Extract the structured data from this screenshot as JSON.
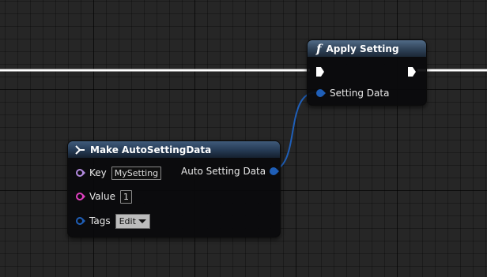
{
  "graph": {
    "background_color": "#262626",
    "grid_color": "#000000",
    "exec_wire_color": "#ffffff",
    "struct_wire_color": "#1f5fb8"
  },
  "apply_node": {
    "icon": "function-icon",
    "icon_glyph": "f",
    "title": "Apply Setting",
    "exec_in_icon": "exec-in-pin-icon",
    "exec_out_icon": "exec-out-pin-icon",
    "input": {
      "label": "Setting Data",
      "pin_color": "#1f5fb8"
    }
  },
  "make_node": {
    "icon": "make-struct-icon",
    "title": "Make AutoSettingData",
    "inputs": [
      {
        "label": "Key",
        "pin_color": "#b48be0",
        "value": "MySetting"
      },
      {
        "label": "Value",
        "pin_color": "#e040c0",
        "value": "1"
      },
      {
        "label": "Tags",
        "pin_color": "#1f5fb8",
        "value": "Edit"
      }
    ],
    "output": {
      "label": "Auto Setting Data",
      "pin_color": "#1f5fb8"
    }
  }
}
